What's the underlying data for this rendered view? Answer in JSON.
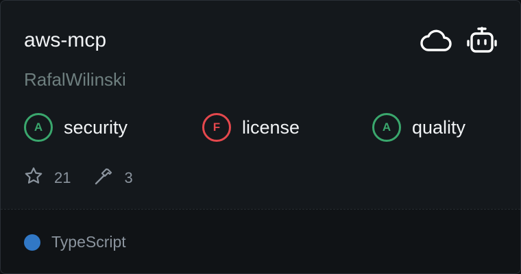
{
  "repo": {
    "name": "aws-mcp",
    "author": "RafalWilinski"
  },
  "header_icons": [
    "cloud-icon",
    "robot-icon"
  ],
  "grades": [
    {
      "letter": "A",
      "label": "security",
      "color": "#3aa76d"
    },
    {
      "letter": "F",
      "label": "license",
      "color": "#e5484d"
    },
    {
      "letter": "A",
      "label": "quality",
      "color": "#3aa76d"
    }
  ],
  "stats": {
    "stars": "21",
    "tools": "3"
  },
  "language": {
    "name": "TypeScript",
    "color": "#3178c6"
  }
}
